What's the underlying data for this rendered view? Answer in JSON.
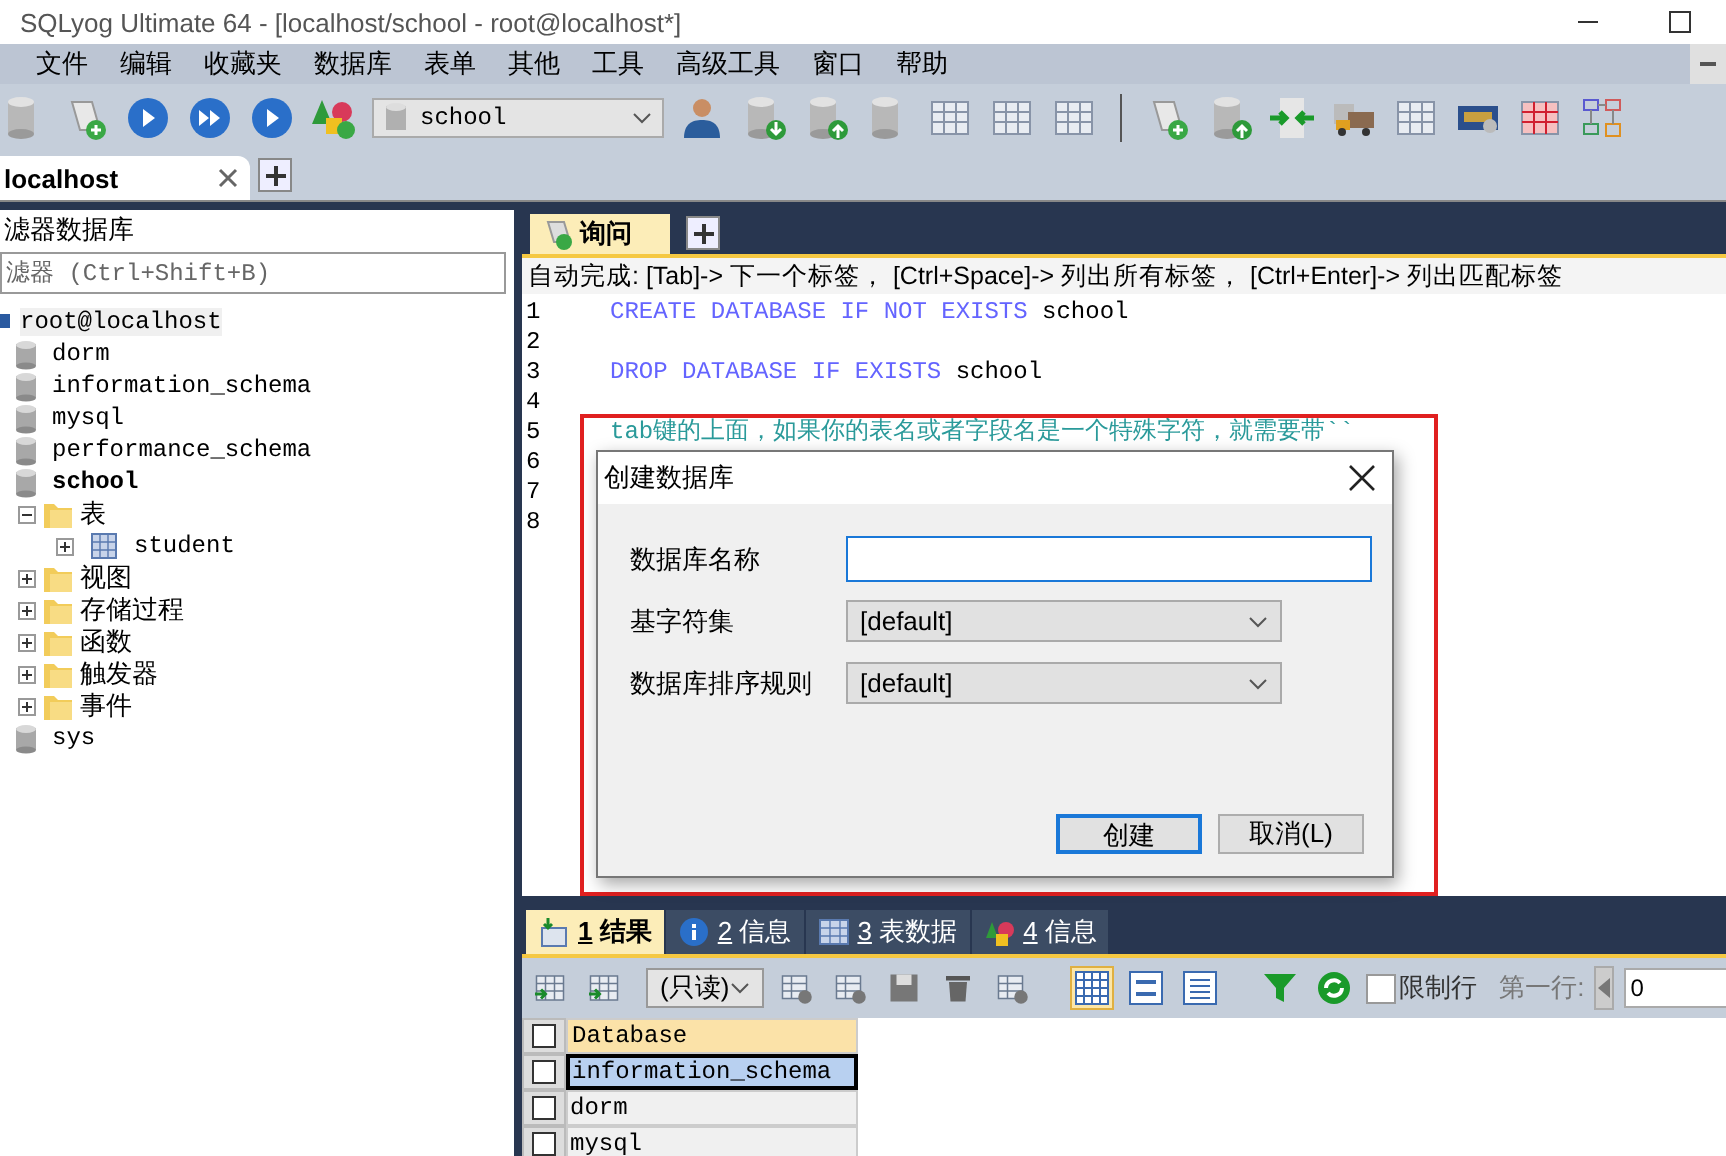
{
  "window": {
    "title": "SQLyog Ultimate 64 - [localhost/school - root@localhost*]"
  },
  "menu": [
    "文件",
    "编辑",
    "收藏夹",
    "数据库",
    "表单",
    "其他",
    "工具",
    "高级工具",
    "窗口",
    "帮助"
  ],
  "toolbar": {
    "database": "school"
  },
  "connection_tabs": [
    {
      "label": "localhost",
      "selected": true
    }
  ],
  "object_browser": {
    "title": "滤器数据库",
    "filter_placeholder": "滤器 (Ctrl+Shift+B)",
    "root": "root@localhost",
    "databases": [
      {
        "name": "dorm",
        "active": false
      },
      {
        "name": "information_schema",
        "active": false
      },
      {
        "name": "mysql",
        "active": false
      },
      {
        "name": "performance_schema",
        "active": false
      },
      {
        "name": "school",
        "active": true,
        "children": [
          {
            "label": "表",
            "kind": "folder",
            "expanded": true,
            "children": [
              {
                "label": "student",
                "kind": "table",
                "expanded": false
              }
            ]
          },
          {
            "label": "视图",
            "kind": "folder",
            "expanded": false
          },
          {
            "label": "存储过程",
            "kind": "folder",
            "expanded": false
          },
          {
            "label": "函数",
            "kind": "folder",
            "expanded": false
          },
          {
            "label": "触发器",
            "kind": "folder",
            "expanded": false
          },
          {
            "label": "事件",
            "kind": "folder",
            "expanded": false
          }
        ]
      },
      {
        "name": "sys",
        "active": false
      }
    ]
  },
  "query_tabs": [
    {
      "label": "询问",
      "selected": true
    }
  ],
  "autocomplete_hint": "自动完成: [Tab]-> 下一个标签， [Ctrl+Space]-> 列出所有标签， [Ctrl+Enter]-> 列出匹配标签",
  "editor": {
    "lines": [
      {
        "number": "1",
        "tokens": [
          {
            "kind": "keyword",
            "text": "CREATE DATABASE IF NOT EXISTS"
          },
          {
            "kind": "plain",
            "text": "school"
          }
        ]
      },
      {
        "number": "2"
      },
      {
        "number": "3",
        "tokens": [
          {
            "kind": "keyword",
            "text": "DROP DATABASE IF EXISTS"
          },
          {
            "kind": "plain",
            "text": "school"
          }
        ]
      },
      {
        "number": "4"
      },
      {
        "number": "5",
        "tokens": [
          {
            "kind": "comment",
            "text": "tab键的上面，如果你的表名或者字段名是一个特殊字符，就需要带``"
          }
        ]
      },
      {
        "number": "6"
      },
      {
        "number": "7"
      },
      {
        "number": "8"
      }
    ]
  },
  "dialog": {
    "title": "创建数据库",
    "fields": [
      {
        "label": "数据库名称",
        "kind": "text"
      },
      {
        "label": "基字符集",
        "kind": "select",
        "value": "[default]"
      },
      {
        "label": "数据库排序规则",
        "kind": "select",
        "value": "[default]"
      }
    ],
    "buttons": [
      {
        "label": "创建",
        "default": true
      },
      {
        "label": "取消(L)",
        "default": false
      }
    ]
  },
  "result_tabs": [
    {
      "number": "1",
      "label": "结果",
      "selected": true,
      "kind": "result"
    },
    {
      "number": "2",
      "label": "信息",
      "selected": false,
      "kind": "info"
    },
    {
      "number": "3",
      "label": "表数据",
      "selected": false,
      "kind": "table"
    },
    {
      "number": "4",
      "label": "信息",
      "selected": false,
      "kind": "shapes"
    }
  ],
  "result_toolbar": {
    "mode": "(只读)",
    "limit_label": "限制行",
    "limit_checked": false,
    "first_row_label": "第一行:",
    "first_row": "0"
  },
  "grid": {
    "column": "Database",
    "header_checked": false,
    "rows": [
      {
        "value": "information_schema",
        "selected": true,
        "checked": false
      },
      {
        "value": "dorm",
        "selected": false,
        "checked": false
      },
      {
        "value": "mysql",
        "selected": false,
        "checked": false
      }
    ]
  }
}
